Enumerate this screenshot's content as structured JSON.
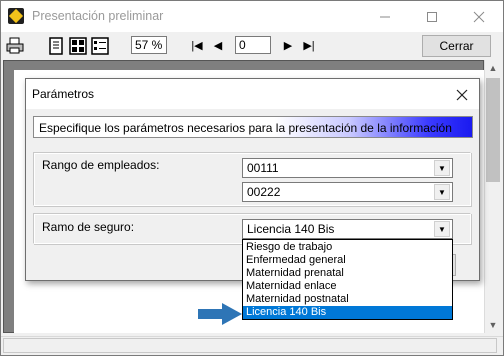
{
  "window": {
    "title": "Presentación preliminar",
    "minimize_icon": "minimize-icon",
    "maximize_icon": "maximize-icon",
    "close_icon": "close-icon"
  },
  "toolbar": {
    "zoom_value": "57 %",
    "page_value": "0",
    "first_page": "|◀",
    "prev_page": "◀",
    "next_page": "▶",
    "last_page": "▶|",
    "close_label": "Cerrar"
  },
  "dialog": {
    "title": "Parámetros",
    "banner": "Especifique los parámetros necesarios para la presentación de la información",
    "employee_range_label": "Rango de empleados:",
    "employee_from": "00111",
    "employee_to": "00222",
    "insurance_label": "Ramo de seguro:",
    "insurance_selected": "Licencia 140 Bis",
    "insurance_options": [
      "Riesgo de trabajo",
      "Enfermedad general",
      "Maternidad prenatal",
      "Maternidad enlace",
      "Maternidad postnatal",
      "Licencia 140 Bis"
    ]
  },
  "colors": {
    "selection": "#0078d7",
    "banner_gradient_end": "#1a1af0",
    "annotation_arrow": "#2e75b6"
  }
}
